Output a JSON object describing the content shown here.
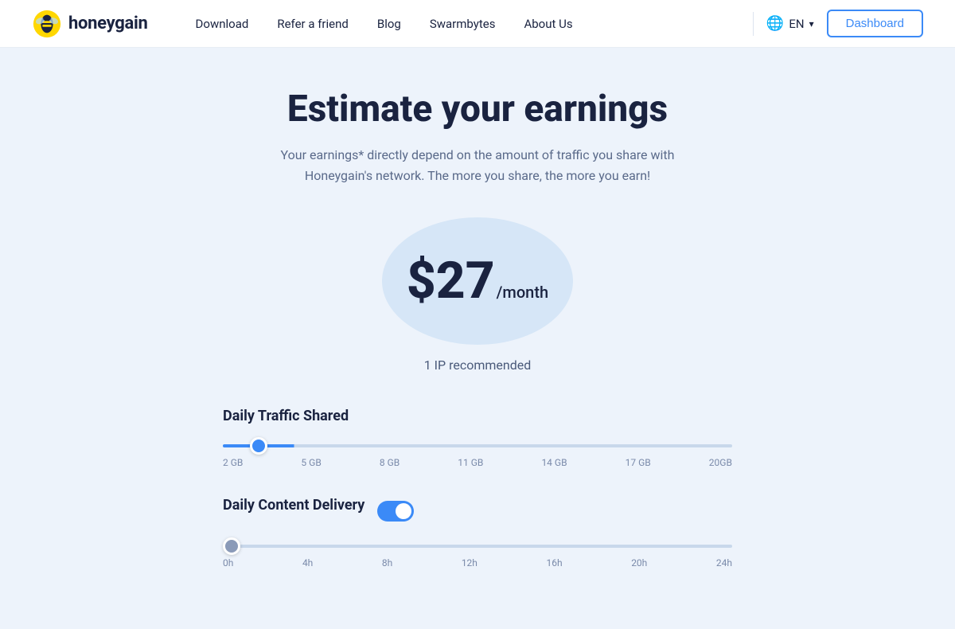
{
  "brand": {
    "name": "honeygain",
    "logoAlt": "Honeygain logo"
  },
  "nav": {
    "links": [
      {
        "label": "Download",
        "id": "download"
      },
      {
        "label": "Refer a friend",
        "id": "refer"
      },
      {
        "label": "Blog",
        "id": "blog"
      },
      {
        "label": "Swarmbytes",
        "id": "swarmbytes"
      },
      {
        "label": "About Us",
        "id": "about"
      }
    ],
    "language": "EN",
    "dashboardBtn": "Dashboard"
  },
  "hero": {
    "title": "Estimate your earnings",
    "subtitle": "Your earnings* directly depend on the amount of traffic you share with Honeygain's network. The more you share, the more you earn!"
  },
  "earnings": {
    "value": "$27",
    "period": "/month",
    "ipRecommended": "1 IP recommended"
  },
  "trafficSlider": {
    "label": "Daily Traffic Shared",
    "min": 2,
    "max": 20,
    "value": 3,
    "ticks": [
      "2 GB",
      "5 GB",
      "8 GB",
      "11 GB",
      "14 GB",
      "17 GB",
      "20GB"
    ]
  },
  "contentDeliverySlider": {
    "label": "Daily Content Delivery",
    "toggleOn": true,
    "min": 0,
    "max": 24,
    "value": 0,
    "ticks": [
      "0h",
      "4h",
      "8h",
      "12h",
      "16h",
      "20h",
      "24h"
    ]
  }
}
